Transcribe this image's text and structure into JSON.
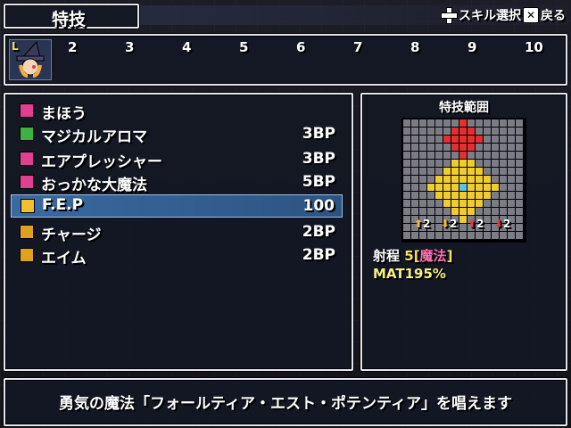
{
  "header": {
    "title": "特技",
    "help_skill_key": "✚",
    "help_skill_label": "スキル選択",
    "help_back_key": "✕",
    "help_back_label": "戻る"
  },
  "party": {
    "leader_badge": "L",
    "slots": [
      "2",
      "3",
      "4",
      "5",
      "6",
      "7",
      "8",
      "9",
      "10"
    ]
  },
  "skills": [
    {
      "name": "まほう",
      "cost": "",
      "icon_color": "#e04090",
      "icon": "magic-icon"
    },
    {
      "name": "マジカルアロマ",
      "cost": "3BP",
      "icon_color": "#40b040",
      "icon": "heal-plus-icon"
    },
    {
      "name": "エアプレッシャー",
      "cost": "3BP",
      "icon_color": "#e04090",
      "icon": "magic-square-icon"
    },
    {
      "name": "おっかな大魔法",
      "cost": "5BP",
      "icon_color": "#e04090",
      "icon": "magic-square-icon"
    },
    {
      "name": "F.E.P",
      "cost": "100",
      "icon_color": "#f0c030",
      "icon": "fep-icon",
      "selected": true
    },
    {
      "name": "チャージ",
      "cost": "2BP",
      "icon_color": "#e0a020",
      "icon": "buff-icon"
    },
    {
      "name": "エイム",
      "cost": "2BP",
      "icon_color": "#e0a020",
      "icon": "buff-icon"
    }
  ],
  "range": {
    "title": "特技範囲",
    "arrows": [
      "2",
      "2",
      "2",
      "2"
    ],
    "range_label": "射程",
    "range_value": "5",
    "range_type_open": "[",
    "range_type": "魔法",
    "range_type_close": "]",
    "mat": "MAT195%",
    "colors": {
      "empty": "#7c7c86",
      "area": "#f0cc30",
      "center": "#60c0f0",
      "caster": "#e03030"
    }
  },
  "description": "勇気の魔法「フォールティア・エスト・ポテンティア」を唱えます"
}
